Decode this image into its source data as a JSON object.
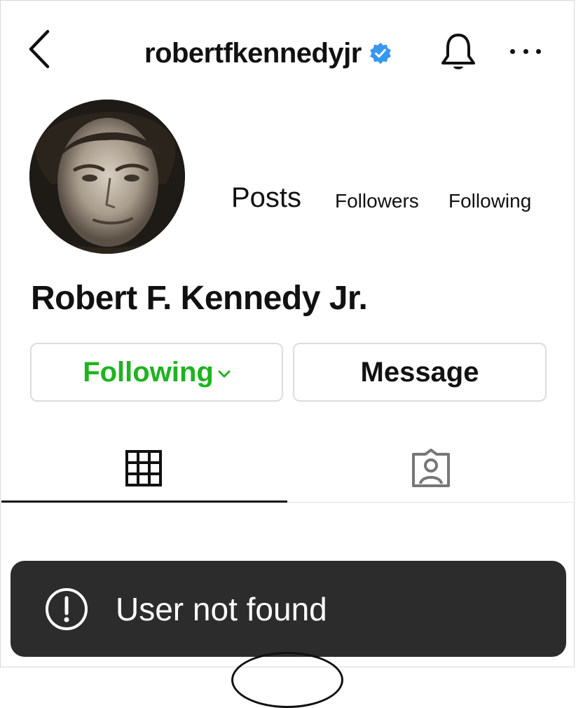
{
  "header": {
    "username": "robertfkennedyjr",
    "verified_color": "#3897f0",
    "icons": {
      "back": "chevron-left-icon",
      "verified": "verified-badge-icon",
      "notifications": "bell-icon",
      "more": "more-horizontal-icon"
    }
  },
  "profile": {
    "full_name": "Robert F. Kennedy Jr.",
    "stats": {
      "posts_label": "Posts",
      "followers_label": "Followers",
      "following_label": "Following"
    }
  },
  "actions": {
    "following_label": "Following",
    "following_color": "#1fb31f",
    "message_label": "Message"
  },
  "tabs": [
    {
      "name": "posts-grid",
      "icon": "grid-icon",
      "active": true
    },
    {
      "name": "tagged",
      "icon": "tagged-user-icon",
      "active": false
    }
  ],
  "toast": {
    "icon": "exclamation-circle-icon",
    "message": "User not found"
  }
}
